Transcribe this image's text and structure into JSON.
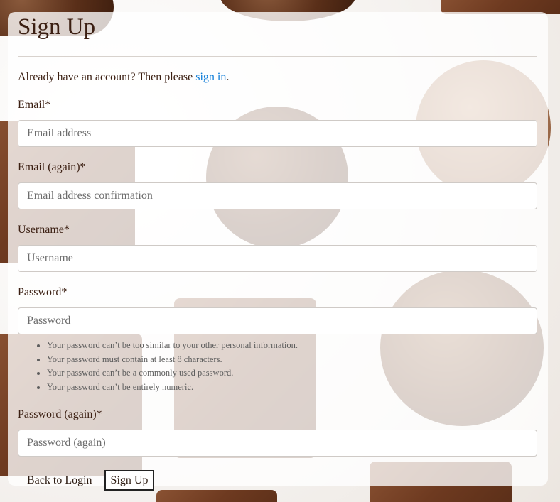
{
  "page": {
    "title": "Sign Up"
  },
  "signin_note": {
    "text": "Already have an account? Then please ",
    "link_label": "sign in",
    "suffix": "."
  },
  "fields": {
    "email": {
      "label": "Email*",
      "placeholder": "Email address",
      "value": ""
    },
    "email_again": {
      "label": "Email (again)*",
      "placeholder": "Email address confirmation",
      "value": ""
    },
    "username": {
      "label": "Username*",
      "placeholder": "Username",
      "value": ""
    },
    "password": {
      "label": "Password*",
      "placeholder": "Password",
      "value": "",
      "help": [
        "Your password can’t be too similar to your other personal information.",
        "Your password must contain at least 8 characters.",
        "Your password can’t be a commonly used password.",
        "Your password can’t be entirely numeric."
      ]
    },
    "password_again": {
      "label": "Password (again)*",
      "placeholder": "Password (again)",
      "value": ""
    }
  },
  "actions": {
    "back_label": "Back to Login",
    "submit_label": "Sign Up"
  },
  "colors": {
    "link": "#0a7bd8",
    "text": "#3b1f12",
    "card_background": "rgba(255,255,255,0.78)"
  }
}
